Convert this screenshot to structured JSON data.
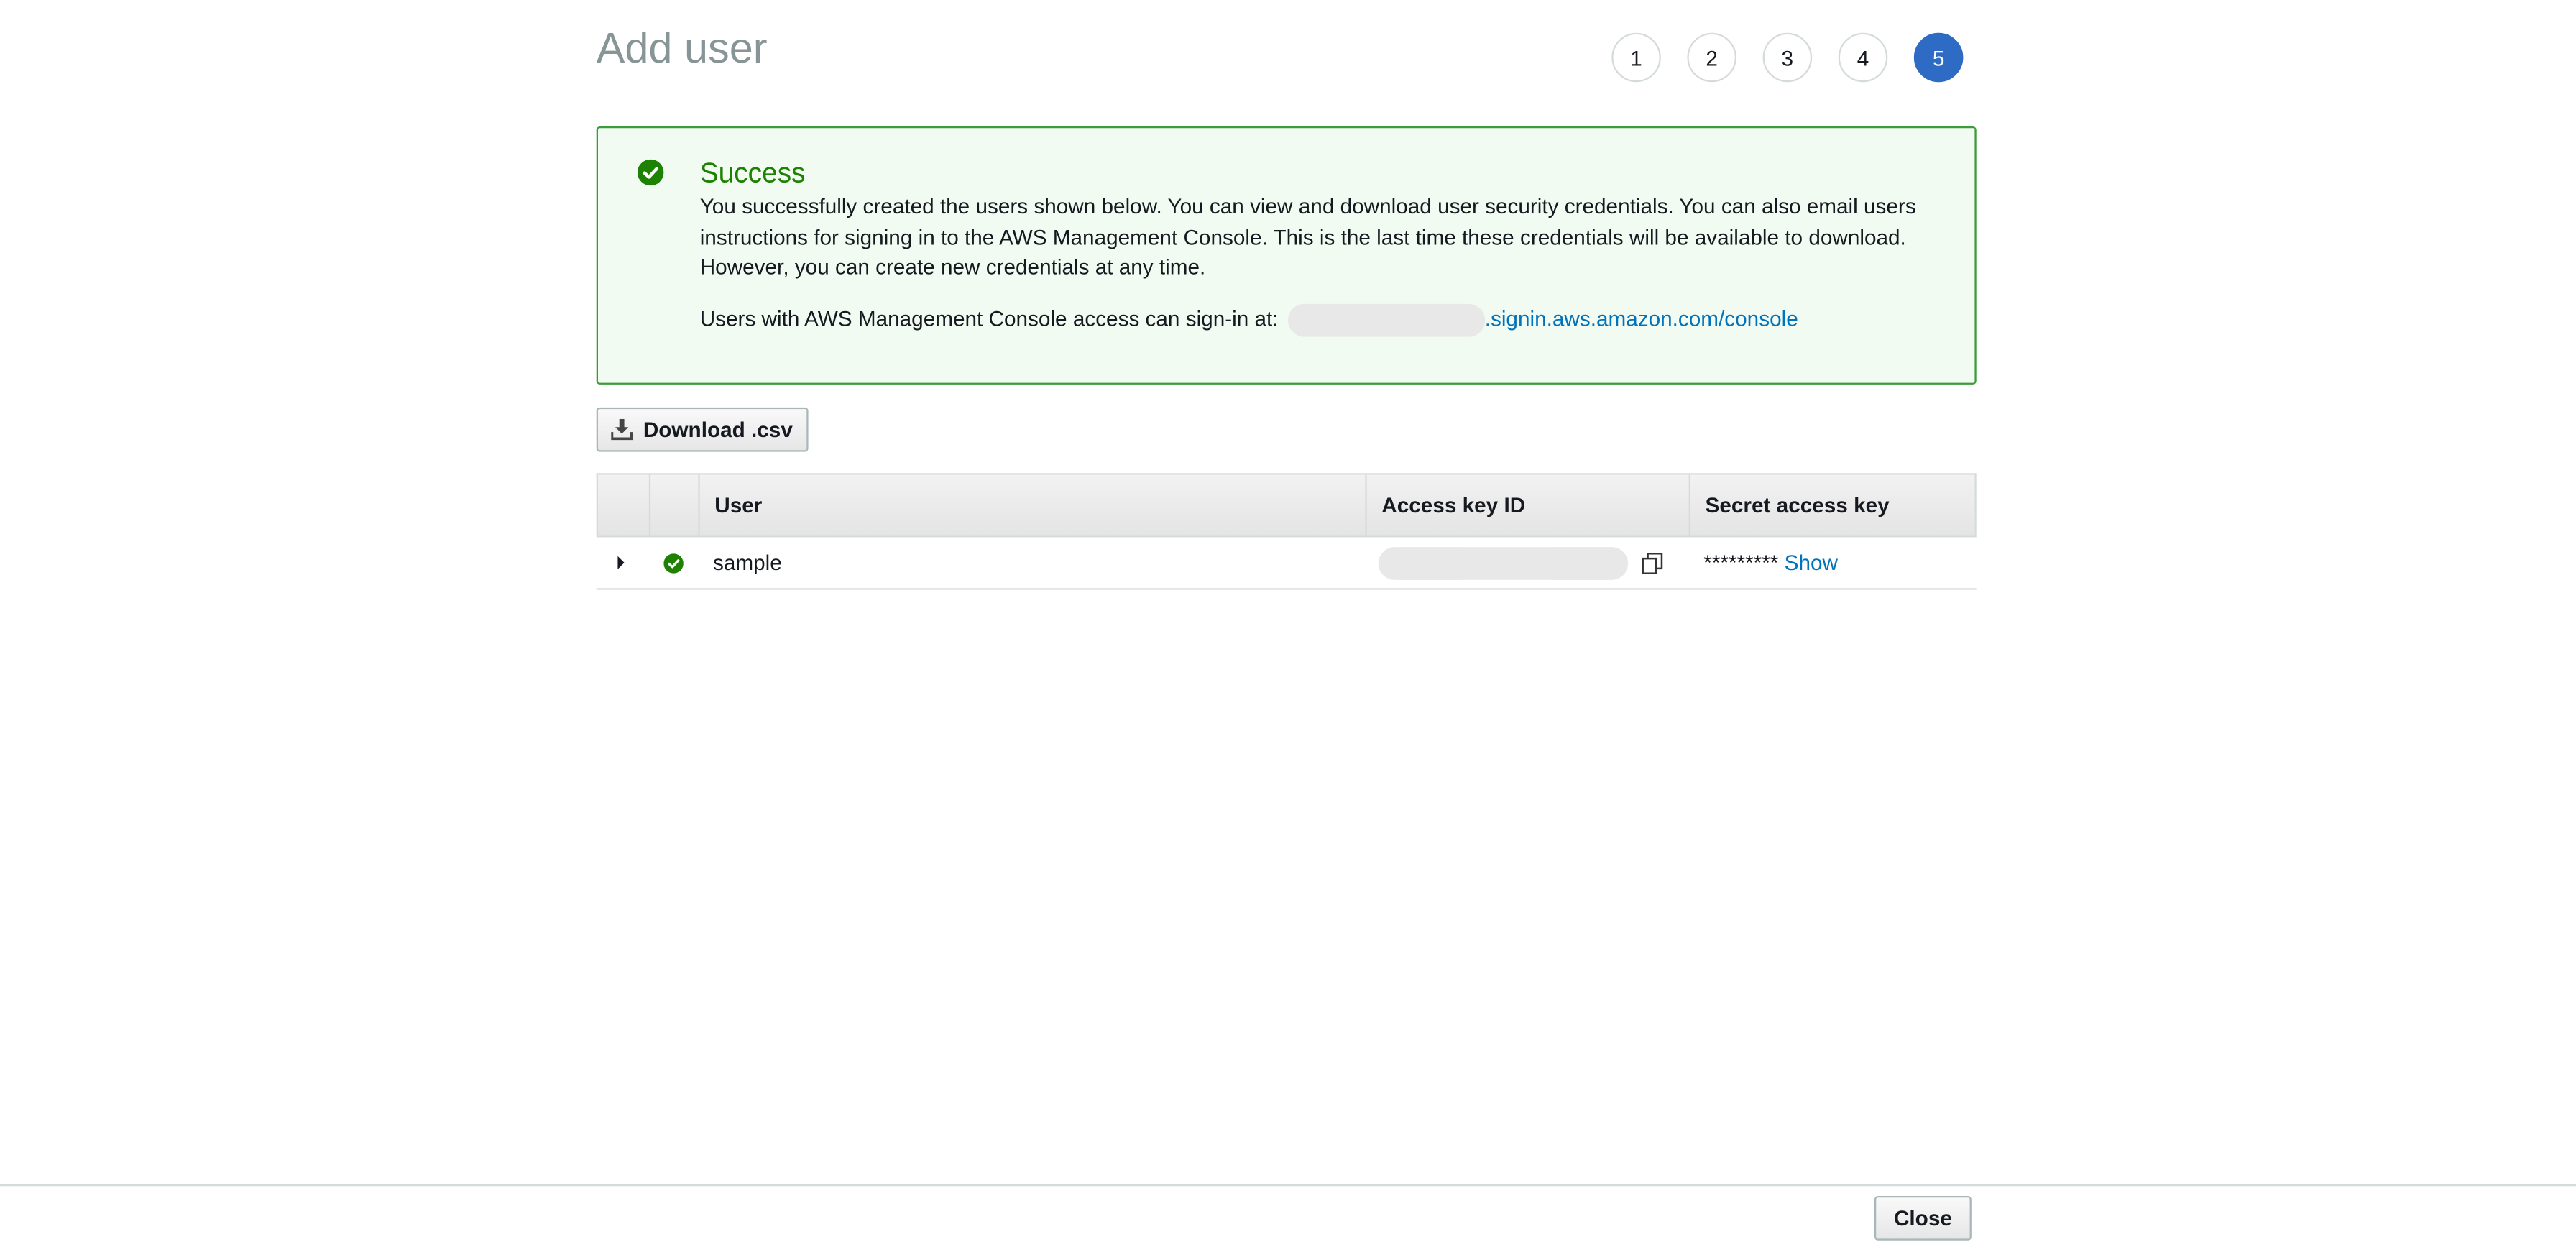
{
  "header": {
    "title": "Add user",
    "steps": [
      "1",
      "2",
      "3",
      "4",
      "5"
    ],
    "active_step": 5
  },
  "flash": {
    "title": "Success",
    "message": "You successfully created the users shown below. You can view and download user security credentials. You can also email users instructions for signing in to the AWS Management Console. This is the last time these credentials will be available to download. However, you can create new credentials at any time.",
    "signin_prefix": "Users with AWS Management Console access can sign-in at:",
    "signin_link": ".signin.aws.amazon.com/console"
  },
  "toolbar": {
    "download_label": "Download .csv"
  },
  "table": {
    "columns": [
      "User",
      "Access key ID",
      "Secret access key"
    ],
    "rows": [
      {
        "user": "sample",
        "secret_masked": "*********",
        "show_label": "Show"
      }
    ]
  },
  "footer": {
    "close_label": "Close"
  },
  "colors": {
    "accent": "#2e6bc4",
    "success": "#1d8102",
    "link": "#0073bb"
  }
}
